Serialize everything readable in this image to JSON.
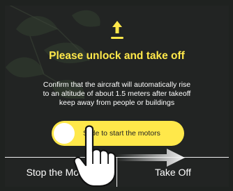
{
  "dialog": {
    "title": "Please unlock and take off",
    "description_lines": [
      "Confirm that the aircraft will automatically rise",
      "to an altitude of about 1.5 meters after takeoff",
      "keep away from people or buildings"
    ]
  },
  "slider": {
    "label": "Slide to start the motors"
  },
  "buttons": {
    "stop": "Stop the Motors",
    "takeoff": "Take Off"
  },
  "icons": {
    "takeoff": "takeoff-icon",
    "hand": "hand-pointer-icon",
    "arrow": "swipe-right-arrow-icon"
  },
  "colors": {
    "accent": "#ffe84a",
    "background": "#2a2c2b",
    "text": "#ffffff"
  }
}
